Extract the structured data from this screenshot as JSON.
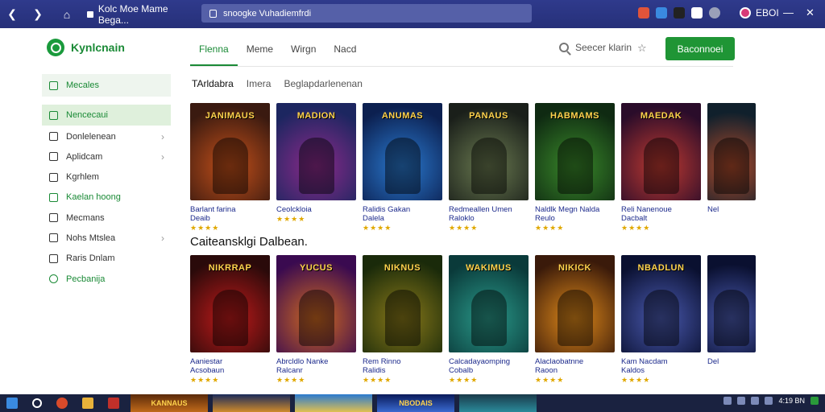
{
  "browser": {
    "tab_title": "Kolc Moe Mame Bega...",
    "url": "snoogke Vuhadiemfrdi",
    "profile_label": "EBOI"
  },
  "site": {
    "logo_text": "Kynlcnain",
    "nav": [
      "Flenna",
      "Meme",
      "Wirgn",
      "Nacd"
    ],
    "active_nav": "Flenna",
    "search_label": "Seecer klarin",
    "cta_label": "Baconnoei"
  },
  "sidebar": {
    "items": [
      {
        "label": "Mecales",
        "icon": "store-icon"
      },
      {
        "label": "Nencecaui",
        "icon": "grid-icon"
      },
      {
        "label": "Donlelenean",
        "icon": "download-icon",
        "chevron": true
      },
      {
        "label": "Aplidcam",
        "icon": "apps-icon",
        "chevron": true
      },
      {
        "label": "Kgrhlem",
        "icon": "chart-icon"
      },
      {
        "label": "Kaelan hoong",
        "icon": "folder-icon"
      },
      {
        "label": "Mecmans",
        "icon": "message-icon"
      },
      {
        "label": "Nohs Mtslea",
        "icon": "list-icon",
        "chevron": true
      },
      {
        "label": "Raris Dnlam",
        "icon": "tag-icon"
      },
      {
        "label": "Pecbanija",
        "icon": "info-icon"
      }
    ]
  },
  "subnav": [
    "TArldabra",
    "Imera",
    "Beglapdarlenenan"
  ],
  "section2_title": "Caiteansklgi Dalbean.",
  "row1": [
    {
      "cover": "JANIMAUS",
      "t1": "Barlant farina",
      "t2": "Deaib",
      "stars": "★★★★",
      "c1": "#3a1a10",
      "c2": "#c4501a"
    },
    {
      "cover": "MADION",
      "t1": "Ceolckloia",
      "t2": "",
      "stars": "★★★★",
      "c1": "#1c2660",
      "c2": "#8d2a8a"
    },
    {
      "cover": "ANUMAS",
      "t1": "Ralidis Gakan",
      "t2": "Dalela",
      "stars": "★★★★",
      "c1": "#0c2050",
      "c2": "#2a7ad0"
    },
    {
      "cover": "PANAUS",
      "t1": "Redmeallen Umen",
      "t2": "Raloklo",
      "stars": "★★★★",
      "c1": "#1a1f1a",
      "c2": "#6a7a50"
    },
    {
      "cover": "HABMAMS",
      "t1": "Naldlk Megn Nalda",
      "t2": "Reulo",
      "stars": "★★★★",
      "c1": "#0f2a12",
      "c2": "#3a8a2a"
    },
    {
      "cover": "MAEDAK",
      "t1": "Reli Nanenoue",
      "t2": "Dacbalt",
      "stars": "★★★★",
      "c1": "#2a0c2a",
      "c2": "#c03a30"
    },
    {
      "cover": "",
      "t1": "Nel",
      "t2": "",
      "stars": "",
      "c1": "#10202c",
      "c2": "#b04a2a"
    }
  ],
  "row2": [
    {
      "cover": "NIKRRAP",
      "t1": "Aaniestar",
      "t2": "Acsobaun",
      "stars": "★★★★",
      "c1": "#2a0a0a",
      "c2": "#c01a1a"
    },
    {
      "cover": "YUCUS",
      "t1": "Abrcldlo Nanke",
      "t2": "Ralcanr",
      "stars": "★★★★",
      "c1": "#3a0a50",
      "c2": "#d06a20"
    },
    {
      "cover": "NIKNUS",
      "t1": "Rem Rinno",
      "t2": "Ralidis",
      "stars": "★★★★",
      "c1": "#1a2a0a",
      "c2": "#8a7a1a"
    },
    {
      "cover": "WAKIMUS",
      "t1": "Calcadayaomping",
      "t2": "Cobalb",
      "stars": "★★★★",
      "c1": "#0a3a3a",
      "c2": "#2a9a8a"
    },
    {
      "cover": "NIKICK",
      "t1": "Alaclaobatnne",
      "t2": "Raoon",
      "stars": "★★★★",
      "c1": "#3a1a0a",
      "c2": "#e08a1a"
    },
    {
      "cover": "NBADLUN",
      "t1": "Kam Nacdam",
      "t2": "Kaldos",
      "stars": "★★★★",
      "c1": "#0a1030",
      "c2": "#4a5ab0"
    },
    {
      "cover": "",
      "t1": "Del",
      "t2": "",
      "stars": "",
      "c1": "#0a1030",
      "c2": "#4a5ab0"
    }
  ],
  "taskbar": {
    "thumbs": [
      "KANNAUS",
      "",
      "",
      "NBODAIS",
      ""
    ],
    "time": "4:19 BN"
  }
}
